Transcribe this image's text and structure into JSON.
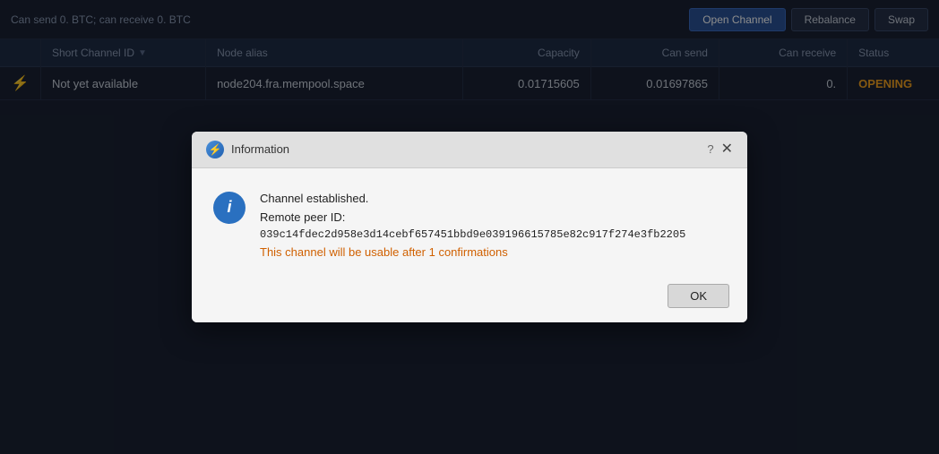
{
  "topbar": {
    "status_text": "Can send 0. BTC; can receive 0. BTC",
    "btn_open_channel": "Open Channel",
    "btn_rebalance": "Rebalance",
    "btn_swap": "Swap"
  },
  "table": {
    "columns": [
      {
        "id": "icon",
        "label": ""
      },
      {
        "id": "scid",
        "label": "Short Channel ID",
        "sortable": true
      },
      {
        "id": "alias",
        "label": "Node alias"
      },
      {
        "id": "capacity",
        "label": "Capacity"
      },
      {
        "id": "can_send",
        "label": "Can send"
      },
      {
        "id": "can_receive",
        "label": "Can receive"
      },
      {
        "id": "status",
        "label": "Status"
      }
    ],
    "rows": [
      {
        "icon": "⚡",
        "scid": "Not yet available",
        "alias": "node204.fra.mempool.space",
        "capacity": "0.01715605",
        "can_send": "0.01697865",
        "can_receive": "0.",
        "status": "OPENING"
      }
    ]
  },
  "dialog": {
    "title": "Information",
    "help_icon": "?",
    "close_icon": "✕",
    "logo_letter": "⚡",
    "info_icon": "i",
    "message_line1": "Channel established.",
    "message_line2": "Remote peer ID:",
    "peer_id": "039c14fdec2d958e3d14cebf657451bbd9e039196615785e82c917f274e3fb2205",
    "confirmation_notice": "This channel will be usable after 1 confirmations",
    "btn_ok": "OK"
  }
}
